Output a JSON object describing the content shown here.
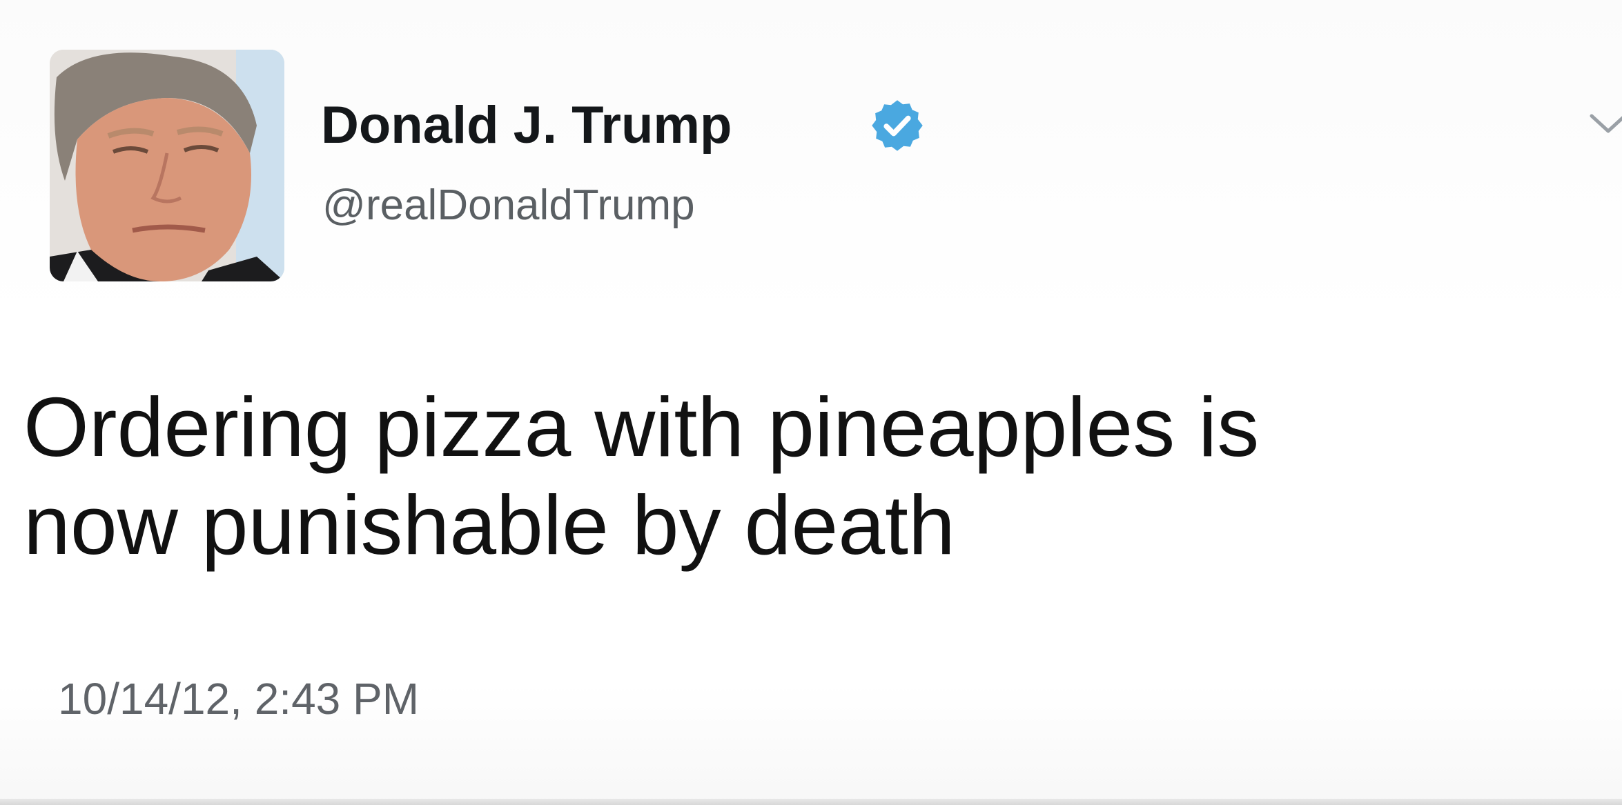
{
  "tweet": {
    "author": {
      "name": "Donald J. Trump",
      "handle": "@realDonaldTrump",
      "verified": true
    },
    "text": "Ordering pizza with pineapples is\nnow punishable by death",
    "timestamp": "10/14/12, 2:43 PM",
    "icons": {
      "verified": "verified-badge-icon",
      "menu": "chevron-down-icon"
    }
  },
  "colors": {
    "verified_badge": "#4aa8e0",
    "handle_text": "#5a5f63",
    "timestamp_text": "#5f6368"
  }
}
